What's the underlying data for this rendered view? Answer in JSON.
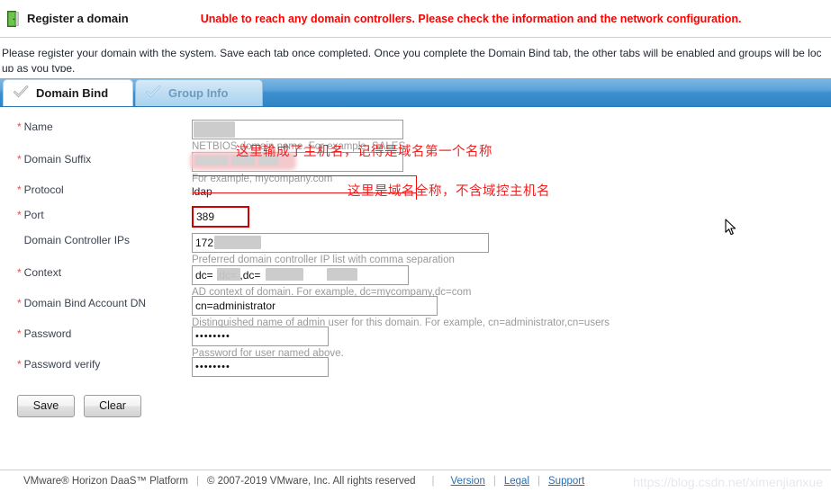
{
  "header": {
    "icon": "green-door-icon",
    "title": "Register a domain",
    "error_message": "Unable to reach any domain controllers. Please check the information and the network configuration."
  },
  "intro": {
    "line1": "Please register your domain with the system. Save each tab once completed. Once you complete the Domain Bind tab, the other tabs will be enabled and groups will be loc",
    "line2": "up as you type."
  },
  "tabs": [
    {
      "label": "Domain Bind",
      "icon": "check-icon",
      "state": "active"
    },
    {
      "label": "Group Info",
      "icon": "check-icon",
      "state": "disabled"
    }
  ],
  "form": {
    "name": {
      "label": "Name",
      "required": "*",
      "value": "",
      "redacted": true,
      "hint": "NETBIOS domain name. For example, SALES."
    },
    "domain_suffix": {
      "label": "Domain Suffix",
      "required": "*",
      "value": "",
      "redacted": true,
      "hint": "For example, mycompany.com"
    },
    "protocol": {
      "label": "Protocol",
      "required": "*",
      "value": "ldap"
    },
    "port": {
      "label": "Port",
      "required": "*",
      "value": "389",
      "error": true
    },
    "domain_controller_ips": {
      "label": "Domain Controller IPs",
      "required": "",
      "value": "172",
      "redacted": true,
      "hint": "Preferred domain controller IP list with comma separation"
    },
    "context": {
      "label": "Context",
      "required": "*",
      "value": "dc=        ,dc=             ,dc=",
      "redacted": true,
      "hint": "AD context of domain. For example, dc=mycompany,dc=com"
    },
    "bind_account_dn": {
      "label": "Domain Bind Account DN",
      "required": "*",
      "value": "cn=administrator",
      "hint": "Distinguished name of admin user for this domain. For example, cn=administrator,cn=users"
    },
    "password": {
      "label": "Password",
      "required": "*",
      "value": "••••••••",
      "hint": "Password for user named above."
    },
    "password_verify": {
      "label": "Password verify",
      "required": "*",
      "value": "••••••••"
    }
  },
  "buttons": {
    "save": "Save",
    "clear": "Clear"
  },
  "annotations": [
    {
      "text": "这里输成了主机名，记得是域名第一个名称",
      "target": "name-field"
    },
    {
      "text": "这里是域名全称，不含域控主机名",
      "target": "domain-suffix-field"
    }
  ],
  "footer": {
    "product": "VMware® Horizon DaaS™ Platform",
    "copyright": "© 2007-2019 VMware, Inc. All rights reserved",
    "links": [
      "Version",
      "Legal",
      "Support"
    ]
  },
  "watermark": "https://blog.csdn.net/ximenjianxue",
  "colors": {
    "error_red": "#ff0000",
    "tab_blue": "#3d8fcd",
    "annotation_red": "#ee2222",
    "link_blue": "#2b6cb0"
  }
}
